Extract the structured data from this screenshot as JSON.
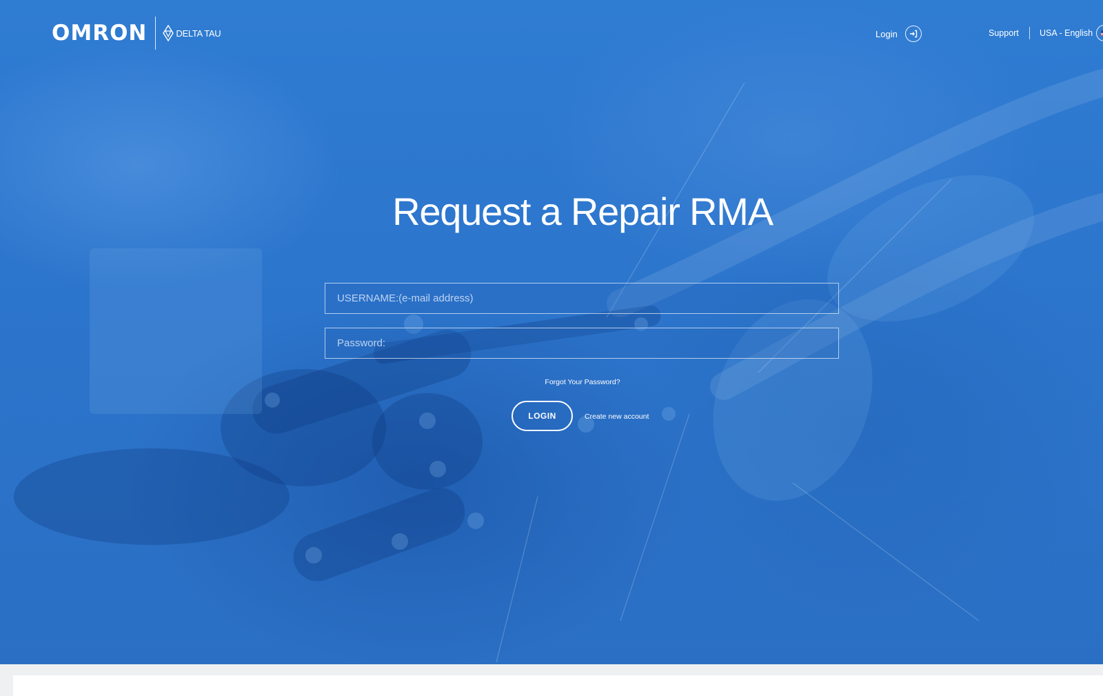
{
  "brand": {
    "logo_text": "OMRON",
    "sub_logo_text": "DELTA TAU"
  },
  "nav": {
    "login_label": "Login",
    "login_icon": "login-arrow-icon",
    "support_label": "Support",
    "region_label": "USA - English",
    "region_icon": "us-flag-icon"
  },
  "main": {
    "title": "Request a Repair RMA",
    "username_placeholder": "USERNAME:(e-mail address)",
    "password_placeholder": "Password:",
    "forgot_label": "Forgot Your Password?",
    "login_button_label": "LOGIN",
    "create_account_label": "Create new account"
  },
  "colors": {
    "hero_blue": "#2c75cc",
    "text": "#ffffff",
    "page_background": "#eef0f1"
  }
}
